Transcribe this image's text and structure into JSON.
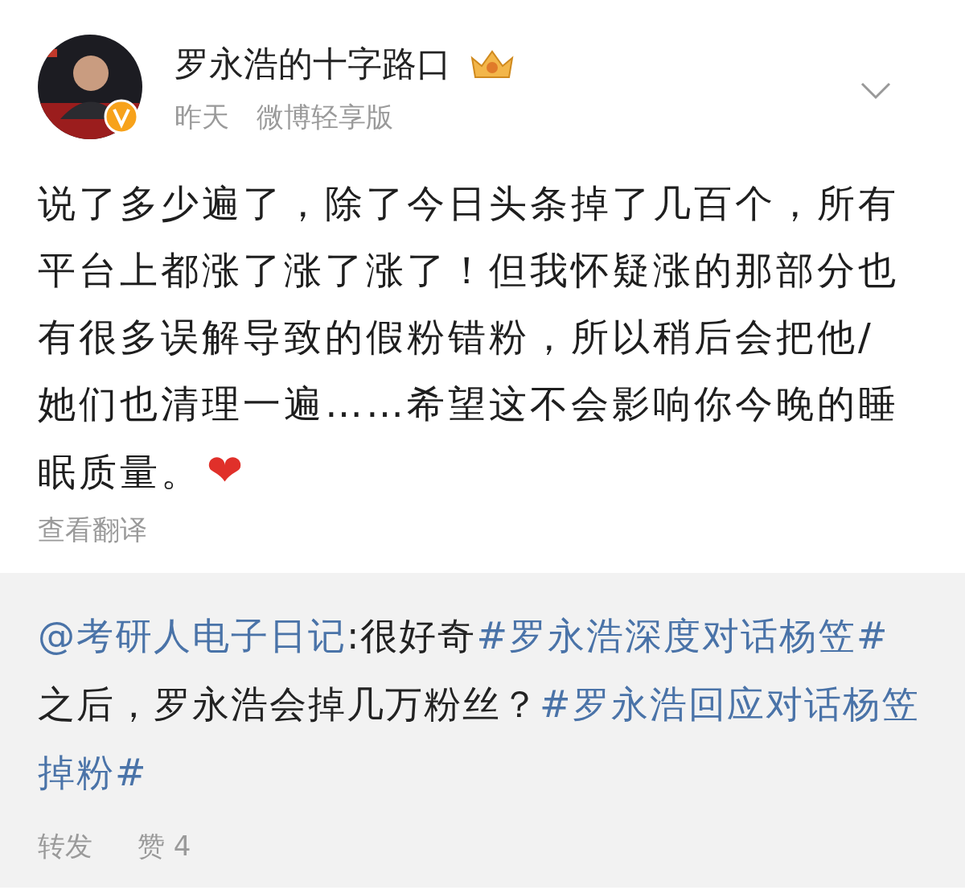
{
  "author": {
    "name": "罗永浩的十字路口",
    "verified": true
  },
  "meta": {
    "time": "昨天",
    "source": "微博轻享版"
  },
  "post": {
    "text": "说了多少遍了，除了今日头条掉了几百个，所有平台上都涨了涨了涨了！但我怀疑涨的那部分也有很多误解导致的假粉错粉，所以稍后会把他/她们也清理一遍……希望这不会影响你今晚的睡眠质量。❤",
    "translate_link": "查看翻译"
  },
  "repost": {
    "segments": [
      {
        "kind": "mention",
        "text": "@考研人电子日记"
      },
      {
        "kind": "text",
        "text": ":很好奇"
      },
      {
        "kind": "hashtag",
        "text": "#罗永浩深度对话杨笠#"
      },
      {
        "kind": "text",
        "text": " 之后，罗永浩会掉几万粉丝？"
      },
      {
        "kind": "hashtag",
        "text": "#罗永浩回应对话杨笠掉粉#"
      }
    ],
    "actions": [
      {
        "label": "转发"
      },
      {
        "label": "赞 4"
      }
    ]
  }
}
